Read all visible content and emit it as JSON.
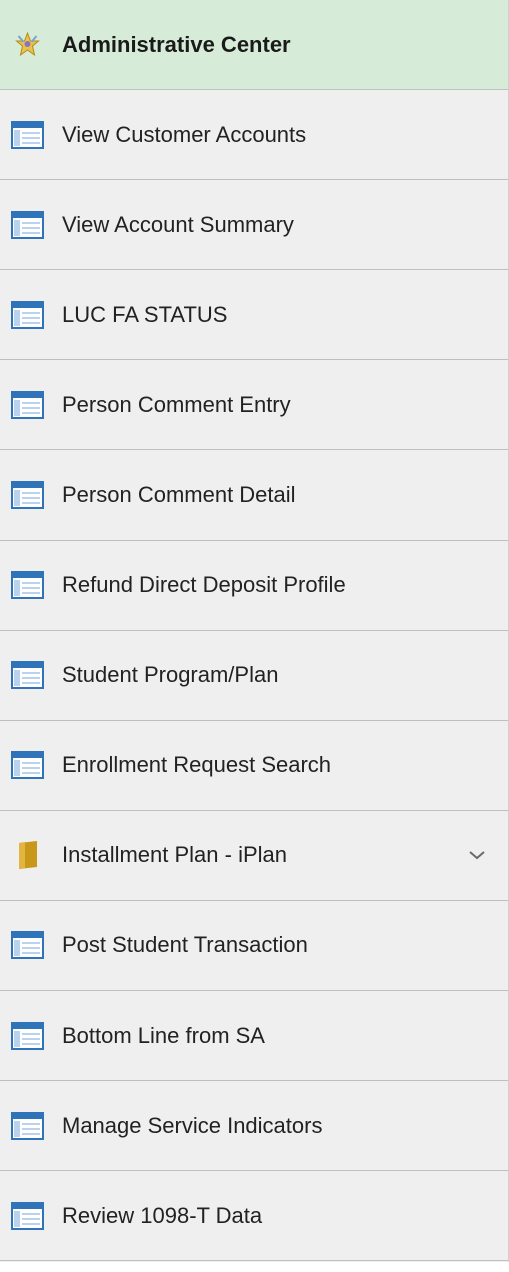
{
  "nav": {
    "header": {
      "label": "Administrative Center",
      "icon": "admin-center-icon"
    },
    "items": [
      {
        "label": "View Customer Accounts",
        "icon": "page-icon",
        "expandable": false
      },
      {
        "label": "View Account Summary",
        "icon": "page-icon",
        "expandable": false
      },
      {
        "label": "LUC FA STATUS",
        "icon": "page-icon",
        "expandable": false
      },
      {
        "label": "Person Comment Entry",
        "icon": "page-icon",
        "expandable": false
      },
      {
        "label": "Person Comment Detail",
        "icon": "page-icon",
        "expandable": false
      },
      {
        "label": "Refund Direct Deposit Profile",
        "icon": "page-icon",
        "expandable": false
      },
      {
        "label": "Student Program/Plan",
        "icon": "page-icon",
        "expandable": false
      },
      {
        "label": "Enrollment Request Search",
        "icon": "page-icon",
        "expandable": false
      },
      {
        "label": "Installment Plan - iPlan",
        "icon": "folder-icon",
        "expandable": true
      },
      {
        "label": "Post Student Transaction",
        "icon": "page-icon",
        "expandable": false
      },
      {
        "label": "Bottom Line from SA",
        "icon": "page-icon",
        "expandable": false
      },
      {
        "label": "Manage Service Indicators",
        "icon": "page-icon",
        "expandable": false
      },
      {
        "label": "Review 1098-T Data",
        "icon": "page-icon",
        "expandable": false
      }
    ]
  },
  "colors": {
    "header_bg": "#d6ecd8",
    "row_bg": "#efefef",
    "divider": "#bfbfbf",
    "page_icon_blue": "#2f73b8",
    "folder_gold": "#c9971a"
  }
}
